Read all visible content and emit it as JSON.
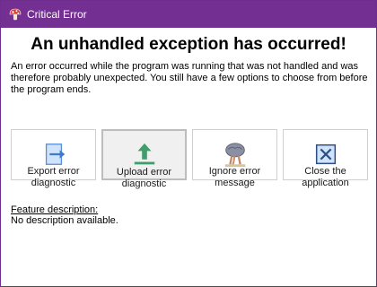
{
  "window": {
    "title": "Critical Error"
  },
  "header": {
    "headline": "An unhandled exception has occurred!",
    "intro": "An error occurred while the program was running that was not handled and was therefore probably unexpected. You still have a few options to choose from before the program ends."
  },
  "options": [
    {
      "label": "Export error\ndiagnostic",
      "icon": "export-icon",
      "selected": false
    },
    {
      "label": "Upload error\ndiagnostic",
      "icon": "upload-icon",
      "selected": true
    },
    {
      "label": "Ignore error\nmessage",
      "icon": "ostrich-icon",
      "selected": false
    },
    {
      "label": "Close the\napplication",
      "icon": "close-app-icon",
      "selected": false
    }
  ],
  "feature": {
    "title": "Feature description:",
    "description": "No description available."
  },
  "colors": {
    "titlebar": "#732f92",
    "accent_blue": "#4a7fd6",
    "accent_green": "#3f9e6d"
  }
}
